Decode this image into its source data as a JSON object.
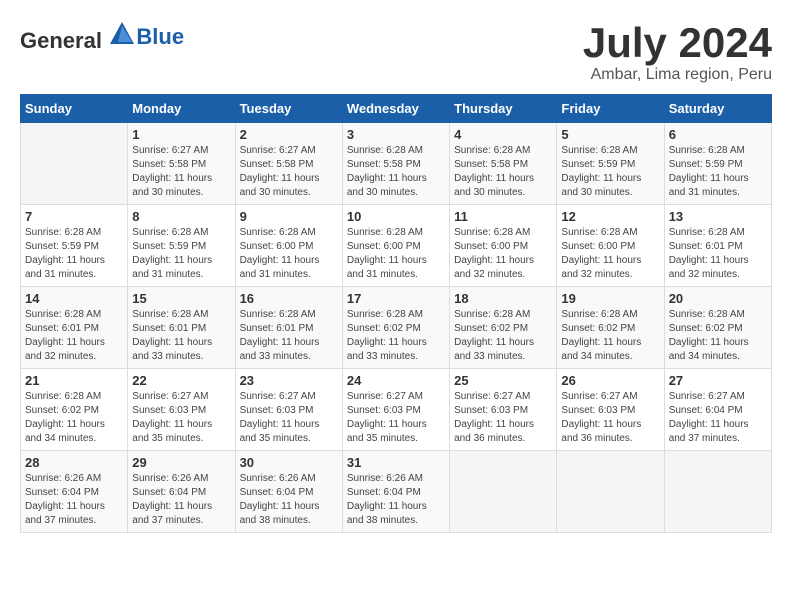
{
  "logo": {
    "text_general": "General",
    "text_blue": "Blue"
  },
  "title": "July 2024",
  "subtitle": "Ambar, Lima region, Peru",
  "days_of_week": [
    "Sunday",
    "Monday",
    "Tuesday",
    "Wednesday",
    "Thursday",
    "Friday",
    "Saturday"
  ],
  "weeks": [
    [
      {
        "num": "",
        "sunrise": "",
        "sunset": "",
        "daylight": "",
        "empty": true
      },
      {
        "num": "1",
        "sunrise": "Sunrise: 6:27 AM",
        "sunset": "Sunset: 5:58 PM",
        "daylight": "Daylight: 11 hours and 30 minutes."
      },
      {
        "num": "2",
        "sunrise": "Sunrise: 6:27 AM",
        "sunset": "Sunset: 5:58 PM",
        "daylight": "Daylight: 11 hours and 30 minutes."
      },
      {
        "num": "3",
        "sunrise": "Sunrise: 6:28 AM",
        "sunset": "Sunset: 5:58 PM",
        "daylight": "Daylight: 11 hours and 30 minutes."
      },
      {
        "num": "4",
        "sunrise": "Sunrise: 6:28 AM",
        "sunset": "Sunset: 5:58 PM",
        "daylight": "Daylight: 11 hours and 30 minutes."
      },
      {
        "num": "5",
        "sunrise": "Sunrise: 6:28 AM",
        "sunset": "Sunset: 5:59 PM",
        "daylight": "Daylight: 11 hours and 30 minutes."
      },
      {
        "num": "6",
        "sunrise": "Sunrise: 6:28 AM",
        "sunset": "Sunset: 5:59 PM",
        "daylight": "Daylight: 11 hours and 31 minutes."
      }
    ],
    [
      {
        "num": "7",
        "sunrise": "Sunrise: 6:28 AM",
        "sunset": "Sunset: 5:59 PM",
        "daylight": "Daylight: 11 hours and 31 minutes."
      },
      {
        "num": "8",
        "sunrise": "Sunrise: 6:28 AM",
        "sunset": "Sunset: 5:59 PM",
        "daylight": "Daylight: 11 hours and 31 minutes."
      },
      {
        "num": "9",
        "sunrise": "Sunrise: 6:28 AM",
        "sunset": "Sunset: 6:00 PM",
        "daylight": "Daylight: 11 hours and 31 minutes."
      },
      {
        "num": "10",
        "sunrise": "Sunrise: 6:28 AM",
        "sunset": "Sunset: 6:00 PM",
        "daylight": "Daylight: 11 hours and 31 minutes."
      },
      {
        "num": "11",
        "sunrise": "Sunrise: 6:28 AM",
        "sunset": "Sunset: 6:00 PM",
        "daylight": "Daylight: 11 hours and 32 minutes."
      },
      {
        "num": "12",
        "sunrise": "Sunrise: 6:28 AM",
        "sunset": "Sunset: 6:00 PM",
        "daylight": "Daylight: 11 hours and 32 minutes."
      },
      {
        "num": "13",
        "sunrise": "Sunrise: 6:28 AM",
        "sunset": "Sunset: 6:01 PM",
        "daylight": "Daylight: 11 hours and 32 minutes."
      }
    ],
    [
      {
        "num": "14",
        "sunrise": "Sunrise: 6:28 AM",
        "sunset": "Sunset: 6:01 PM",
        "daylight": "Daylight: 11 hours and 32 minutes."
      },
      {
        "num": "15",
        "sunrise": "Sunrise: 6:28 AM",
        "sunset": "Sunset: 6:01 PM",
        "daylight": "Daylight: 11 hours and 33 minutes."
      },
      {
        "num": "16",
        "sunrise": "Sunrise: 6:28 AM",
        "sunset": "Sunset: 6:01 PM",
        "daylight": "Daylight: 11 hours and 33 minutes."
      },
      {
        "num": "17",
        "sunrise": "Sunrise: 6:28 AM",
        "sunset": "Sunset: 6:02 PM",
        "daylight": "Daylight: 11 hours and 33 minutes."
      },
      {
        "num": "18",
        "sunrise": "Sunrise: 6:28 AM",
        "sunset": "Sunset: 6:02 PM",
        "daylight": "Daylight: 11 hours and 33 minutes."
      },
      {
        "num": "19",
        "sunrise": "Sunrise: 6:28 AM",
        "sunset": "Sunset: 6:02 PM",
        "daylight": "Daylight: 11 hours and 34 minutes."
      },
      {
        "num": "20",
        "sunrise": "Sunrise: 6:28 AM",
        "sunset": "Sunset: 6:02 PM",
        "daylight": "Daylight: 11 hours and 34 minutes."
      }
    ],
    [
      {
        "num": "21",
        "sunrise": "Sunrise: 6:28 AM",
        "sunset": "Sunset: 6:02 PM",
        "daylight": "Daylight: 11 hours and 34 minutes."
      },
      {
        "num": "22",
        "sunrise": "Sunrise: 6:27 AM",
        "sunset": "Sunset: 6:03 PM",
        "daylight": "Daylight: 11 hours and 35 minutes."
      },
      {
        "num": "23",
        "sunrise": "Sunrise: 6:27 AM",
        "sunset": "Sunset: 6:03 PM",
        "daylight": "Daylight: 11 hours and 35 minutes."
      },
      {
        "num": "24",
        "sunrise": "Sunrise: 6:27 AM",
        "sunset": "Sunset: 6:03 PM",
        "daylight": "Daylight: 11 hours and 35 minutes."
      },
      {
        "num": "25",
        "sunrise": "Sunrise: 6:27 AM",
        "sunset": "Sunset: 6:03 PM",
        "daylight": "Daylight: 11 hours and 36 minutes."
      },
      {
        "num": "26",
        "sunrise": "Sunrise: 6:27 AM",
        "sunset": "Sunset: 6:03 PM",
        "daylight": "Daylight: 11 hours and 36 minutes."
      },
      {
        "num": "27",
        "sunrise": "Sunrise: 6:27 AM",
        "sunset": "Sunset: 6:04 PM",
        "daylight": "Daylight: 11 hours and 37 minutes."
      }
    ],
    [
      {
        "num": "28",
        "sunrise": "Sunrise: 6:26 AM",
        "sunset": "Sunset: 6:04 PM",
        "daylight": "Daylight: 11 hours and 37 minutes."
      },
      {
        "num": "29",
        "sunrise": "Sunrise: 6:26 AM",
        "sunset": "Sunset: 6:04 PM",
        "daylight": "Daylight: 11 hours and 37 minutes."
      },
      {
        "num": "30",
        "sunrise": "Sunrise: 6:26 AM",
        "sunset": "Sunset: 6:04 PM",
        "daylight": "Daylight: 11 hours and 38 minutes."
      },
      {
        "num": "31",
        "sunrise": "Sunrise: 6:26 AM",
        "sunset": "Sunset: 6:04 PM",
        "daylight": "Daylight: 11 hours and 38 minutes."
      },
      {
        "num": "",
        "sunrise": "",
        "sunset": "",
        "daylight": "",
        "empty": true
      },
      {
        "num": "",
        "sunrise": "",
        "sunset": "",
        "daylight": "",
        "empty": true
      },
      {
        "num": "",
        "sunrise": "",
        "sunset": "",
        "daylight": "",
        "empty": true
      }
    ]
  ]
}
